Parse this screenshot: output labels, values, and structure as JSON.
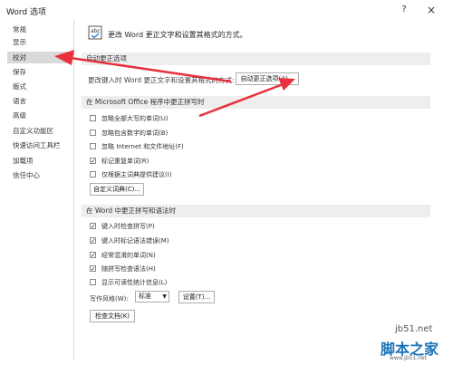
{
  "window": {
    "title": "Word 选项",
    "help": "?",
    "close": "×"
  },
  "sidebar": {
    "items": [
      {
        "label": "常规"
      },
      {
        "label": "显示"
      },
      {
        "label": "校对",
        "selected": true
      },
      {
        "label": "保存"
      },
      {
        "label": "版式"
      },
      {
        "label": "语言"
      },
      {
        "label": "高级"
      },
      {
        "label": "自定义功能区"
      },
      {
        "label": "快速访问工具栏"
      },
      {
        "label": "加载项"
      },
      {
        "label": "信任中心"
      }
    ]
  },
  "main": {
    "header_text": "更改 Word 更正文字和设置其格式的方式。",
    "autocorrect": {
      "section_title": "自动更正选项",
      "description": "更改键入时 Word 更正文字和设置其格式的方式:",
      "button": "自动更正选项(A)..."
    },
    "office_section": {
      "title": "在 Microsoft Office 程序中更正拼写时",
      "options": [
        {
          "label": "忽略全部大写的单词(U)",
          "checked": false
        },
        {
          "label": "忽略包含数字的单词(B)",
          "checked": false
        },
        {
          "label": "忽略 Internet 和文件地址(F)",
          "checked": false
        },
        {
          "label": "标记重复单词(R)",
          "checked": true
        },
        {
          "label": "仅根据主词典提供建议(I)",
          "checked": false
        }
      ],
      "custom_dict_button": "自定义词典(C)..."
    },
    "word_section": {
      "title": "在 Word 中更正拼写和语法时",
      "options": [
        {
          "label": "键入时检查拼写(P)",
          "checked": true
        },
        {
          "label": "键入时标记语法错误(M)",
          "checked": true
        },
        {
          "label": "经常混淆的单词(N)",
          "checked": true
        },
        {
          "label": "随拼写检查语法(H)",
          "checked": true
        },
        {
          "label": "显示可读性统计信息(L)",
          "checked": false
        }
      ],
      "writing_style_label": "写作风格(W):",
      "writing_style_value": "标准",
      "settings_button": "设置(T)...",
      "check_doc_button": "检查文档(K)"
    }
  },
  "watermark": {
    "url": "jb51.net",
    "brand": "脚本之家",
    "sub": "www.jb51.net"
  },
  "colors": {
    "accent_arrow": "#e8313f",
    "selected_bg": "#d9d9d9",
    "section_bg": "#eeeeee"
  }
}
